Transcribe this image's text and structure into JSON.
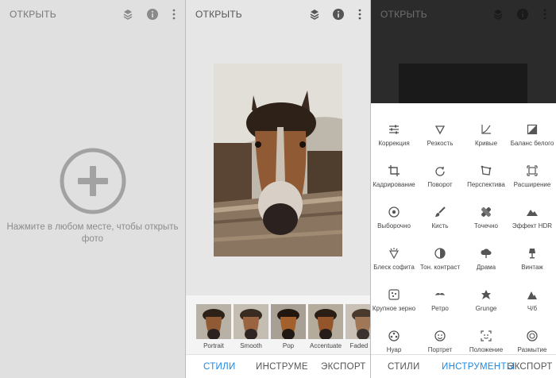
{
  "colors": {
    "accent": "#1e88e5",
    "icon_gray": "#666666",
    "hint_gray": "#8c8c8c"
  },
  "screen1": {
    "open_label": "ОТКРЫТЬ",
    "hint": "Нажмите в любом месте, чтобы открыть фото",
    "icons": [
      "layers-icon",
      "info-icon",
      "more-vert-icon",
      "add-circle-icon"
    ]
  },
  "screen2": {
    "open_label": "ОТКРЫТЬ",
    "styles": [
      {
        "label": "Portrait"
      },
      {
        "label": "Smooth"
      },
      {
        "label": "Pop"
      },
      {
        "label": "Accentuate"
      },
      {
        "label": "Faded Gl"
      }
    ],
    "tabs": {
      "styles": "СТИЛИ",
      "tools": "ИНСТРУМЕ",
      "export": "ЭКСПОРТ"
    },
    "active_tab": "styles"
  },
  "screen3": {
    "open_label": "ОТКРЫТЬ",
    "tools": [
      {
        "label": "Коррекция",
        "icon": "tune-icon"
      },
      {
        "label": "Резкость",
        "icon": "triangle-icon"
      },
      {
        "label": "Кривые",
        "icon": "curves-icon"
      },
      {
        "label": "Баланс белого",
        "icon": "white-balance-icon"
      },
      {
        "label": "Кадрирование",
        "icon": "crop-icon"
      },
      {
        "label": "Поворот",
        "icon": "rotate-icon"
      },
      {
        "label": "Перспектива",
        "icon": "perspective-icon"
      },
      {
        "label": "Расширение",
        "icon": "expand-icon"
      },
      {
        "label": "Выборочно",
        "icon": "selective-icon"
      },
      {
        "label": "Кисть",
        "icon": "brush-icon"
      },
      {
        "label": "Точечно",
        "icon": "healing-icon"
      },
      {
        "label": "Эффект HDR",
        "icon": "hdr-icon"
      },
      {
        "label": "Блеск софита",
        "icon": "glamour-icon"
      },
      {
        "label": "Тон. контраст",
        "icon": "tonal-contrast-icon"
      },
      {
        "label": "Драма",
        "icon": "drama-icon"
      },
      {
        "label": "Винтаж",
        "icon": "vintage-icon"
      },
      {
        "label": "Крупное зерно",
        "icon": "grain-icon"
      },
      {
        "label": "Ретро",
        "icon": "retro-icon"
      },
      {
        "label": "Grunge",
        "icon": "grunge-icon"
      },
      {
        "label": "Ч/б",
        "icon": "bw-icon"
      },
      {
        "label": "Нуар",
        "icon": "noir-icon"
      },
      {
        "label": "Портрет",
        "icon": "portrait-icon"
      },
      {
        "label": "Положение",
        "icon": "head-pose-icon"
      },
      {
        "label": "Размытие",
        "icon": "lens-blur-icon"
      }
    ],
    "tabs": {
      "styles": "СТИЛИ",
      "tools": "ИНСТРУМЕНТЫ",
      "export": "ЭКСПОРТ"
    },
    "active_tab": "tools"
  }
}
